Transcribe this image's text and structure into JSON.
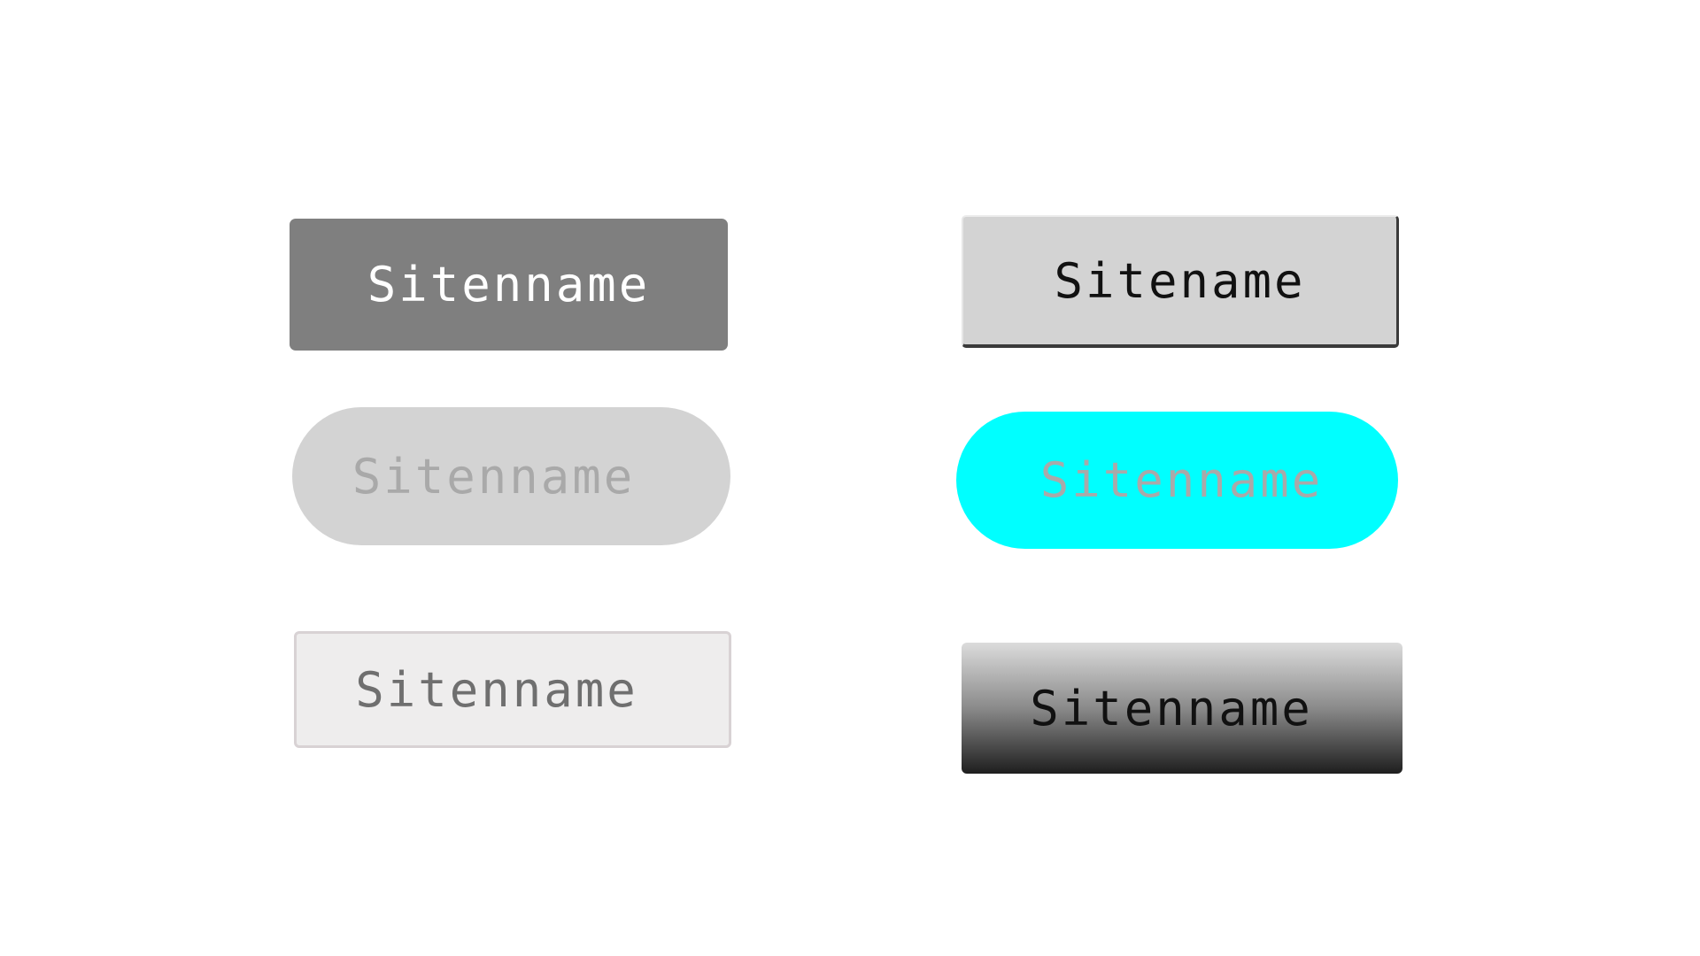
{
  "buttons": {
    "dark": {
      "label": "Sitenname"
    },
    "raised": {
      "label": "Sitename"
    },
    "pill_grey": {
      "label": "Sitenname"
    },
    "pill_cyan": {
      "label": "Sitenname"
    },
    "outline": {
      "label": "Sitenname"
    },
    "gradient": {
      "label": "Sitenname"
    }
  },
  "colors": {
    "dark_bg": "#7f7f7f",
    "raised_bg": "#d3d3d3",
    "pill_grey_bg": "#d3d3d3",
    "pill_cyan_bg": "#00ffff",
    "outline_bg": "#eeeded",
    "gradient_top": "#dcdcdc",
    "gradient_bottom": "#1e1e1e"
  }
}
